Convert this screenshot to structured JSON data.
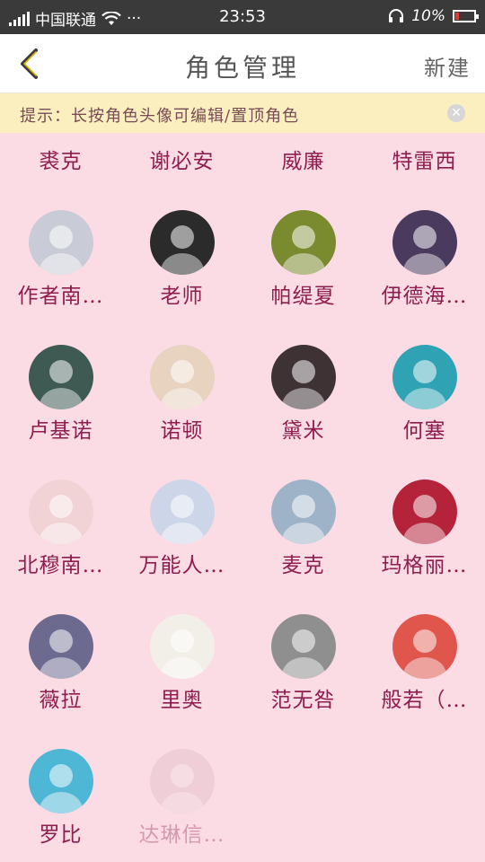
{
  "status_bar": {
    "carrier": "中国联通",
    "more": "···",
    "time": "23:53",
    "battery_percent": "10%"
  },
  "header": {
    "title": "角色管理",
    "action": "新建",
    "back_icon": "chevron-left-icon"
  },
  "tip": {
    "text": "提示：长按角色头像可编辑/置顶角色",
    "close_icon": "close-icon"
  },
  "characters_partial": [
    {
      "name": "裘克"
    },
    {
      "name": "谢必安"
    },
    {
      "name": "威廉"
    },
    {
      "name": "特雷西"
    }
  ],
  "characters": [
    {
      "name": "作者南…",
      "color": "#c9ccd6"
    },
    {
      "name": "老师",
      "color": "#2b2b2b"
    },
    {
      "name": "帕缇夏",
      "color": "#7a8a2e"
    },
    {
      "name": "伊德海…",
      "color": "#4a3a5e"
    },
    {
      "name": "卢基诺",
      "color": "#3f5a52"
    },
    {
      "name": "诺顿",
      "color": "#e8d2c0"
    },
    {
      "name": "黛米",
      "color": "#3e3235"
    },
    {
      "name": "何塞",
      "color": "#2fa3b3"
    },
    {
      "name": "北穆南…",
      "color": "#f1d3d6"
    },
    {
      "name": "万能人…",
      "color": "#cdd6e9"
    },
    {
      "name": "麦克",
      "color": "#9fb3c8"
    },
    {
      "name": "玛格丽…",
      "color": "#b4233a"
    },
    {
      "name": "薇拉",
      "color": "#6d6a8f"
    },
    {
      "name": "里奥",
      "color": "#f2efe8"
    },
    {
      "name": "范无咎",
      "color": "#8f8f8f"
    },
    {
      "name": "般若（…",
      "color": "#e0564d"
    },
    {
      "name": "罗比",
      "color": "#4fb7d6"
    },
    {
      "name": "达琳信…",
      "color": "#d9b7bf",
      "faded": true
    }
  ]
}
